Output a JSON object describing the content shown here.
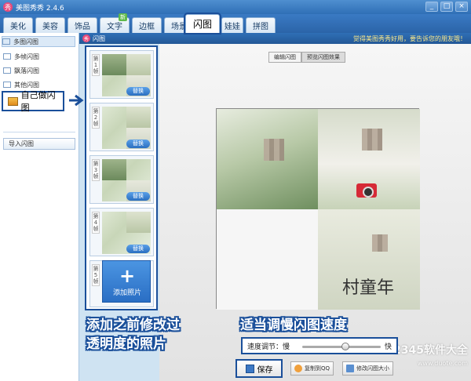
{
  "window": {
    "title": "美图秀秀 2.4.6",
    "logo_glyph": "秀",
    "controls": [
      "_",
      "□",
      "×"
    ]
  },
  "tabs": [
    {
      "label": "美化"
    },
    {
      "label": "美容"
    },
    {
      "label": "饰品"
    },
    {
      "label": "文字",
      "badge": "新"
    },
    {
      "label": "边框"
    },
    {
      "label": "场景"
    },
    {
      "label": "闪图",
      "active": true
    },
    {
      "label": "娃娃"
    },
    {
      "label": "拼图"
    }
  ],
  "sidebar": {
    "items": [
      {
        "label": "多图闪图"
      },
      {
        "label": "多帧闪图"
      },
      {
        "label": "飘落闪图"
      },
      {
        "label": "其他闪图"
      }
    ],
    "custom": {
      "label": "自己做闪图"
    },
    "import_button": "导入闪图"
  },
  "panel": {
    "title": "闪图",
    "logo_glyph": "秀",
    "slogan": "觉得美图秀秀好用，要告诉您的朋友哦！"
  },
  "view_tabs": [
    {
      "label": "编辑闪图"
    },
    {
      "label": "预览闪图效果",
      "active": true
    }
  ],
  "frames": [
    {
      "label": "第1帧",
      "swap": "替换"
    },
    {
      "label": "第2帧",
      "swap": "替换"
    },
    {
      "label": "第3帧",
      "swap": "替换"
    },
    {
      "label": "第4帧",
      "swap": "替换"
    },
    {
      "label": "第5帧"
    }
  ],
  "add_photo": {
    "plus": "+",
    "label": "添加照片"
  },
  "preview": {
    "handwriting": "村童年"
  },
  "speed": {
    "label": "速度调节：慢",
    "fast": "快",
    "level": 0.55
  },
  "buttons": {
    "save": "保存",
    "copy_qq": "复制到QQ",
    "resize": "修改闪图大小"
  },
  "annotations": {
    "left_line1": "添加之前修改过",
    "left_line2": "透明度的照片",
    "right_line1": "适当调慢闪图速度"
  },
  "watermark": {
    "line1": "2345软件大全",
    "line2": "www.duote.com"
  }
}
